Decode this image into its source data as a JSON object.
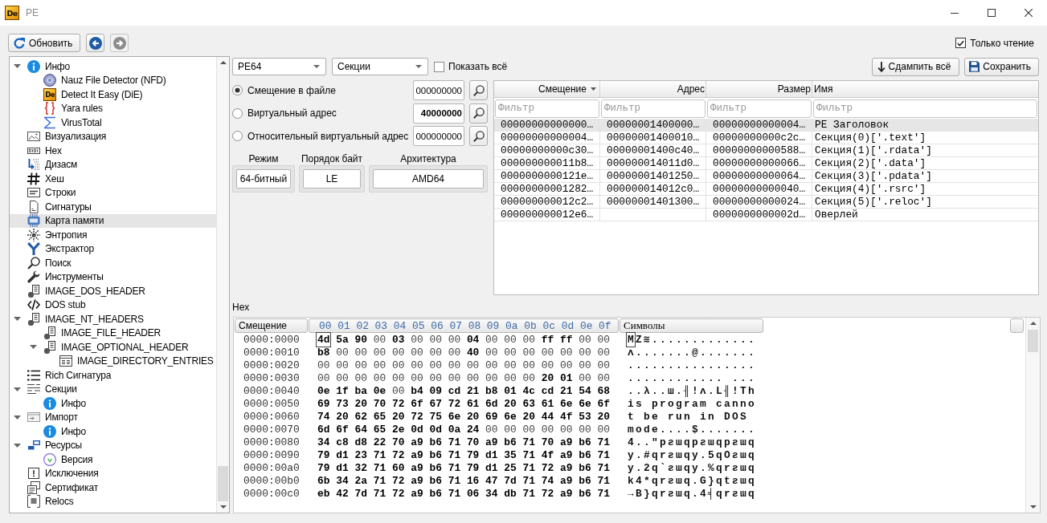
{
  "title_bar": {
    "logo": "De",
    "title": "PE"
  },
  "toolbar": {
    "refresh_button": "Обновить",
    "back_button": {
      "disabled": false
    },
    "forward_button": {
      "disabled": true
    },
    "read_only": {
      "label": "Только чтение",
      "checked": true
    }
  },
  "sidebar": {
    "items": [
      {
        "label": "Инфо",
        "kind": "info",
        "selected": false,
        "expanded": true,
        "children": [
          {
            "label": "Nauz File Detector (NFD)",
            "kind": "nfd",
            "selected": false
          },
          {
            "label": "Detect It Easy (DiE)",
            "kind": "die",
            "logo": "De",
            "selected": false
          },
          {
            "label": "Yara rules",
            "kind": "yara",
            "selected": false
          },
          {
            "label": "VirusTotal",
            "kind": "virustotal",
            "selected": false
          }
        ]
      },
      {
        "label": "Визуализация",
        "kind": "visualization",
        "selected": false
      },
      {
        "label": "Hex",
        "kind": "hex",
        "selected": false
      },
      {
        "label": "Дизасм",
        "kind": "disasm",
        "selected": false
      },
      {
        "label": "Хеш",
        "kind": "hash",
        "selected": false
      },
      {
        "label": "Строки",
        "kind": "strings",
        "selected": false
      },
      {
        "label": "Сигнатуры",
        "kind": "signatures",
        "selected": false
      },
      {
        "label": "Карта памяти",
        "kind": "memorymap",
        "selected": true
      },
      {
        "label": "Энтропия",
        "kind": "entropy",
        "selected": false
      },
      {
        "label": "Экстрактор",
        "kind": "extractor",
        "selected": false
      },
      {
        "label": "Поиск",
        "kind": "search",
        "selected": false
      },
      {
        "label": "Инструменты",
        "kind": "tools",
        "selected": false
      },
      {
        "label": "IMAGE_DOS_HEADER",
        "kind": "header",
        "selected": false
      },
      {
        "label": "DOS stub",
        "kind": "stub",
        "selected": false
      },
      {
        "label": "IMAGE_NT_HEADERS",
        "kind": "header",
        "selected": false,
        "expanded": true,
        "children": [
          {
            "label": "IMAGE_FILE_HEADER",
            "kind": "header",
            "selected": false
          },
          {
            "label": "IMAGE_OPTIONAL_HEADER",
            "kind": "header",
            "selected": false,
            "expanded": true,
            "children": [
              {
                "label": "IMAGE_DIRECTORY_ENTRIES",
                "kind": "directory",
                "selected": false
              }
            ]
          }
        ]
      },
      {
        "label": "Rich Сигнатура",
        "kind": "rich",
        "selected": false
      },
      {
        "label": "Секции",
        "kind": "sections",
        "selected": false,
        "expanded": true,
        "children": [
          {
            "label": "Инфо",
            "kind": "info",
            "selected": false
          }
        ]
      },
      {
        "label": "Импорт",
        "kind": "import",
        "selected": false,
        "expanded": true,
        "children": [
          {
            "label": "Инфо",
            "kind": "info",
            "selected": false
          }
        ]
      },
      {
        "label": "Ресурсы",
        "kind": "resources",
        "selected": false,
        "expanded": true,
        "children": [
          {
            "label": "Версия",
            "kind": "version",
            "selected": false
          }
        ]
      },
      {
        "label": "Исключения",
        "kind": "exceptions",
        "selected": false
      },
      {
        "label": "Сертификат",
        "kind": "certificate",
        "selected": false
      },
      {
        "label": "Relocs",
        "kind": "relocs",
        "selected": false
      }
    ]
  },
  "top_bar": {
    "format_combo": "PE64",
    "view_combo": "Секции",
    "show_all": {
      "label": "Показать всё",
      "checked": false
    },
    "dump_all_button": "Сдампить всё",
    "save_button": "Сохранить"
  },
  "address_panel": {
    "modes": [
      {
        "label": "Смещение в файле",
        "selected": true,
        "value": "000000000",
        "highlighted": false
      },
      {
        "label": "Виртуальный адрес",
        "selected": false,
        "value": "40000000",
        "highlighted": true
      },
      {
        "label": "Относительный виртуальный адрес",
        "selected": false,
        "value": "000000000",
        "highlighted": false
      }
    ],
    "info_groups": [
      {
        "label": "Режим",
        "value": "64-битный"
      },
      {
        "label": "Порядок байт",
        "value": "LE"
      },
      {
        "label": "Архитектура",
        "value": "AMD64"
      }
    ]
  },
  "sections_table": {
    "columns": [
      {
        "label": "Смещение",
        "sorted": true
      },
      {
        "label": "Адрес",
        "sorted": false
      },
      {
        "label": "Размер",
        "sorted": false
      },
      {
        "label": "Имя",
        "sorted": false
      }
    ],
    "filters": [
      {
        "placeholder": "Фильтр"
      },
      {
        "placeholder": "Фильтр"
      },
      {
        "placeholder": "Фильтр"
      },
      {
        "placeholder": "Фильтр"
      }
    ],
    "rows": [
      {
        "offset": "00000000000000…",
        "address": "00000001400000…",
        "size": "00000000000004…",
        "name": "PE Заголовок",
        "selected": true
      },
      {
        "offset": "00000000000004…",
        "address": "00000001400010…",
        "size": "00000000000c2c…",
        "name": "Секция(0)['.text']",
        "selected": false
      },
      {
        "offset": "00000000000c30…",
        "address": "00000001400c40…",
        "size": "00000000000588…",
        "name": "Секция(1)['.rdata']",
        "selected": false
      },
      {
        "offset": "000000000011b8…",
        "address": "000000014011d0…",
        "size": "00000000000066…",
        "name": "Секция(2)['.data']",
        "selected": false
      },
      {
        "offset": "0000000000121e…",
        "address": "00000001401250…",
        "size": "00000000000064…",
        "name": "Секция(3)['.pdata']",
        "selected": false
      },
      {
        "offset": "00000000001282…",
        "address": "000000014012c0…",
        "size": "00000000000040…",
        "name": "Секция(4)['.rsrc']",
        "selected": false
      },
      {
        "offset": "000000000012c2…",
        "address": "00000001401300…",
        "size": "00000000000024…",
        "name": "Секция(5)['.reloc']",
        "selected": false
      },
      {
        "offset": "000000000012e6…",
        "size": "0000000000002d…",
        "name": "Оверлей",
        "selected": false
      }
    ]
  },
  "hex_view": {
    "title": "Hex",
    "offset_header": "Смещение",
    "bytes_header": "00 01 02 03 04 05 06 07 08 09 0a 0b 0c 0d 0e 0f",
    "symbols_header": "Символы",
    "rows": [
      {
        "offset": "0000:0000",
        "bytes": "4d 5a 90 00 03 00 00 00 04 00 00 00 ff ff 00 00",
        "symbols": "MZ≋.............",
        "cursor": true
      },
      {
        "offset": "0000:0010",
        "bytes": "b8 00 00 00 00 00 00 00 40 00 00 00 00 00 00 00",
        "symbols": "ʌ.......@.......",
        "cursor": false
      },
      {
        "offset": "0000:0020",
        "bytes": "00 00 00 00 00 00 00 00 00 00 00 00 00 00 00 00",
        "symbols": "................",
        "cursor": false
      },
      {
        "offset": "0000:0030",
        "bytes": "00 00 00 00 00 00 00 00 00 00 00 00 20 01 00 00",
        "symbols": "............ ...",
        "cursor": false
      },
      {
        "offset": "0000:0040",
        "bytes": "0e 1f ba 0e 00 b4 09 cd 21 b8 01 4c cd 21 54 68",
        "symbols": "..λ..ш.╢!ʌ.L╢!Th",
        "cursor": false
      },
      {
        "offset": "0000:0050",
        "bytes": "69 73 20 70 72 6f 67 72 61 6d 20 63 61 6e 6e 6f",
        "symbols": "is program canno",
        "cursor": false
      },
      {
        "offset": "0000:0060",
        "bytes": "74 20 62 65 20 72 75 6e 20 69 6e 20 44 4f 53 20",
        "symbols": "t be run in DOS ",
        "cursor": false
      },
      {
        "offset": "0000:0070",
        "bytes": "6d 6f 64 65 2e 0d 0d 0a 24 00 00 00 00 00 00 00",
        "symbols": "mode....$.......",
        "cursor": false
      },
      {
        "offset": "0000:0080",
        "bytes": "34 c8 d8 22 70 a9 b6 71 70 a9 b6 71 70 a9 b6 71",
        "symbols": "4..\"pƨɯqpƨɯqpƨɯq",
        "cursor": false
      },
      {
        "offset": "0000:0090",
        "bytes": "79 d1 23 71 72 a9 b6 71 79 d1 35 71 4f a9 b6 71",
        "symbols": "y.#qrƨɯqy.5qOƨɯq",
        "cursor": false
      },
      {
        "offset": "0000:00a0",
        "bytes": "79 d1 32 71 60 a9 b6 71 79 d1 25 71 72 a9 b6 71",
        "symbols": "y.2q`ƨɯqy.%qrƨɯq",
        "cursor": false
      },
      {
        "offset": "0000:00b0",
        "bytes": "6b 34 2a 71 72 a9 b6 71 16 47 7d 71 74 a9 b6 71",
        "symbols": "k4*qrƨɯq.G}qtƨɯq",
        "cursor": false
      },
      {
        "offset": "0000:00c0",
        "bytes": "eb 42 7d 71 72 a9 b6 71 06 34 db 71 72 a9 b6 71",
        "symbols": "→B}qrƨɯq.4╡qrƨɯq",
        "cursor": false
      }
    ]
  }
}
